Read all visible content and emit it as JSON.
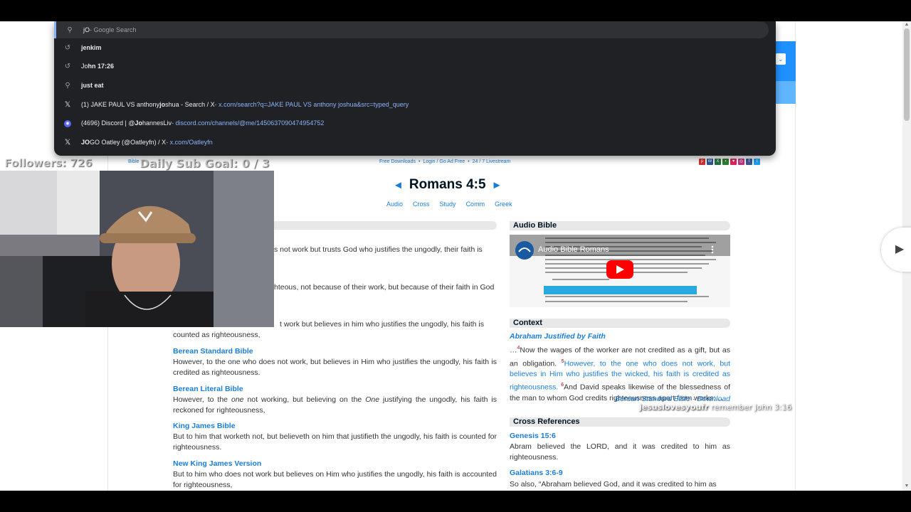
{
  "omnibox": {
    "typed": "jO",
    "suffix": " - Google Search",
    "suggestions": [
      {
        "icon": "history-icon",
        "pre": "",
        "bold": "jenkim",
        "post": "",
        "url": ""
      },
      {
        "icon": "history-icon",
        "pre": "Jo",
        "bold": "hn 17:26",
        "post": "",
        "url": ""
      },
      {
        "icon": "search-icon",
        "pre": "",
        "bold": "just eat",
        "post": "",
        "url": ""
      },
      {
        "icon": "x-icon",
        "pre": "(1) JAKE PAUL VS anthony ",
        "bold": "jo",
        "post": "shua - Search / X",
        "url": " - x.com/search?q=JAKE PAUL VS anthony joshua&src=typed_query"
      },
      {
        "icon": "discord-icon",
        "pre": "(4696) Discord | @",
        "bold": "Jo",
        "post": "hannesLiv",
        "url": " - discord.com/channels/@me/1450637090474954752"
      },
      {
        "icon": "x-icon",
        "pre": "",
        "bold": "JO",
        "post": "GO Oatley (@Oatleyfn) / X",
        "url": " - x.com/Oatleyfn"
      }
    ]
  },
  "overlay": {
    "followers": "Followers: 726",
    "sub_goal": "Daily Sub Goal:  0 / 3",
    "chat_user": "jesuslovesyoufr",
    "chat_msg": " remember John 3:16"
  },
  "site_nav": {
    "left": "Bible",
    "center": [
      "Free Downloads",
      "Login / Go Ad Free",
      "24 / 7 Livestream"
    ]
  },
  "verse": {
    "reference": "Romans 4:5",
    "prev": "◄",
    "next": "►",
    "tabs": [
      "Audio",
      "Cross",
      "Study",
      "Comm",
      "Greek"
    ]
  },
  "partial_lines": {
    "line1": "s not work but trusts God who justifies the ungodly, their faith is",
    "line2": "hteous, not because of their work, but because of their faith in God",
    "line3": "t work but believes in him who justifies the ungodly, his faith is",
    "line3b": "counted as righteousness,"
  },
  "versions": [
    {
      "name": "Berean Standard Bible",
      "text": "However, to the one who does not work, but believes in Him who justifies the ungodly, his faith is credited as righteousness."
    },
    {
      "name": "Berean Literal Bible",
      "text_a": "However, to the ",
      "em1": "one",
      "text_b": " not working, but believing on the ",
      "em2": "One",
      "text_c": " justifying the ungodly, his faith is reckoned for righteousness,"
    },
    {
      "name": "King James Bible",
      "text": "But to him that worketh not, but believeth on him that justifieth the ungodly, his faith is counted for righteousness."
    },
    {
      "name": "New King James Version",
      "text": "But to him who does not work but believes on Him who justifies the ungodly, his faith is accounted for righteousness,"
    }
  ],
  "audio": {
    "heading": "Audio Bible",
    "video_title": "Audio Bible Romans"
  },
  "context": {
    "heading": "Context",
    "title": "Abraham Justified by Faith",
    "lead": "…",
    "v4num": "4",
    "v4": "Now the wages of the worker are not credited as a gift, but as an obligation.",
    "v5num": "5",
    "v5": "However, to the one who does not work, but believes in Him who justifies the wicked, his faith is credited as righteousness.",
    "v6num": "6",
    "v6": "And David speaks likewise of the blessedness of the man to whom God credits righteousness apart from works:…",
    "source": "Berean Standard Bible",
    "sep": " · ",
    "download": "Download"
  },
  "cross_refs": {
    "heading": "Cross References",
    "items": [
      {
        "ref": "Genesis 15:6",
        "text": "Abram believed the LORD, and it was credited to him as righteousness."
      },
      {
        "ref": "Galatians 3:6-9",
        "text": "So also, “Abraham believed God, and it was credited to him as"
      }
    ]
  },
  "colors": {
    "link": "#1a7dd7",
    "omnibox_bg": "#202124",
    "omnibox_url": "#8ab4f8",
    "verse_red": "#c05050"
  }
}
